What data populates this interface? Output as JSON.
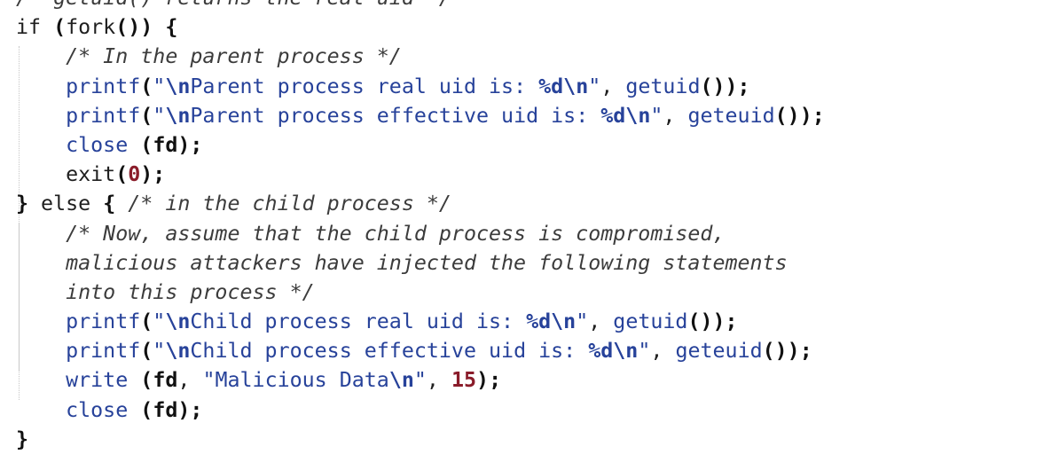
{
  "code_lines": [
    [
      {
        "t": "/* getuid() returns the real uid */",
        "c": "c-cmt"
      }
    ],
    [
      {
        "t": "if ",
        "c": "c-kw"
      },
      {
        "t": "(",
        "c": "c-punct"
      },
      {
        "t": "fork",
        "c": "c-fn"
      },
      {
        "t": "()) {",
        "c": "c-punct"
      }
    ],
    [
      {
        "t": "    ",
        "c": "c-plain"
      },
      {
        "t": "/* In the parent process */",
        "c": "c-cmt"
      }
    ],
    [
      {
        "t": "    ",
        "c": "c-plain"
      },
      {
        "t": "printf",
        "c": "c-call"
      },
      {
        "t": "(",
        "c": "c-punct"
      },
      {
        "t": "\"",
        "c": "c-str"
      },
      {
        "t": "\\n",
        "c": "c-esc"
      },
      {
        "t": "Parent process real uid is: ",
        "c": "c-str"
      },
      {
        "t": "%d\\n",
        "c": "c-esc"
      },
      {
        "t": "\"",
        "c": "c-str"
      },
      {
        "t": ", ",
        "c": "c-plain"
      },
      {
        "t": "getuid",
        "c": "c-call"
      },
      {
        "t": "());",
        "c": "c-punct"
      }
    ],
    [
      {
        "t": "    ",
        "c": "c-plain"
      },
      {
        "t": "printf",
        "c": "c-call"
      },
      {
        "t": "(",
        "c": "c-punct"
      },
      {
        "t": "\"",
        "c": "c-str"
      },
      {
        "t": "\\n",
        "c": "c-esc"
      },
      {
        "t": "Parent process effective uid is: ",
        "c": "c-str"
      },
      {
        "t": "%d\\n",
        "c": "c-esc"
      },
      {
        "t": "\"",
        "c": "c-str"
      },
      {
        "t": ", ",
        "c": "c-plain"
      },
      {
        "t": "geteuid",
        "c": "c-call"
      },
      {
        "t": "());",
        "c": "c-punct"
      }
    ],
    [
      {
        "t": "    ",
        "c": "c-plain"
      },
      {
        "t": "close",
        "c": "c-call"
      },
      {
        "t": " (",
        "c": "c-punct"
      },
      {
        "t": "fd",
        "c": "c-bold"
      },
      {
        "t": ");",
        "c": "c-punct"
      }
    ],
    [
      {
        "t": "    ",
        "c": "c-plain"
      },
      {
        "t": "exit",
        "c": "c-fn"
      },
      {
        "t": "(",
        "c": "c-punct"
      },
      {
        "t": "0",
        "c": "c-num"
      },
      {
        "t": ");",
        "c": "c-punct"
      }
    ],
    [
      {
        "t": "}",
        "c": "c-punct"
      },
      {
        "t": " else ",
        "c": "c-kw"
      },
      {
        "t": "{ ",
        "c": "c-punct"
      },
      {
        "t": "/* in the child process */",
        "c": "c-cmt"
      }
    ],
    [
      {
        "t": "    ",
        "c": "c-plain"
      },
      {
        "t": "/* Now, assume that the child process is compromised,",
        "c": "c-cmt"
      }
    ],
    [
      {
        "t": "    ",
        "c": "c-plain"
      },
      {
        "t": "malicious attackers have injected the following statements",
        "c": "c-cmt"
      }
    ],
    [
      {
        "t": "    ",
        "c": "c-plain"
      },
      {
        "t": "into this process */",
        "c": "c-cmt"
      }
    ],
    [
      {
        "t": "    ",
        "c": "c-plain"
      },
      {
        "t": "printf",
        "c": "c-call"
      },
      {
        "t": "(",
        "c": "c-punct"
      },
      {
        "t": "\"",
        "c": "c-str"
      },
      {
        "t": "\\n",
        "c": "c-esc"
      },
      {
        "t": "Child process real uid is: ",
        "c": "c-str"
      },
      {
        "t": "%d\\n",
        "c": "c-esc"
      },
      {
        "t": "\"",
        "c": "c-str"
      },
      {
        "t": ", ",
        "c": "c-plain"
      },
      {
        "t": "getuid",
        "c": "c-call"
      },
      {
        "t": "());",
        "c": "c-punct"
      }
    ],
    [
      {
        "t": "    ",
        "c": "c-plain"
      },
      {
        "t": "printf",
        "c": "c-call"
      },
      {
        "t": "(",
        "c": "c-punct"
      },
      {
        "t": "\"",
        "c": "c-str"
      },
      {
        "t": "\\n",
        "c": "c-esc"
      },
      {
        "t": "Child process effective uid is: ",
        "c": "c-str"
      },
      {
        "t": "%d\\n",
        "c": "c-esc"
      },
      {
        "t": "\"",
        "c": "c-str"
      },
      {
        "t": ", ",
        "c": "c-plain"
      },
      {
        "t": "geteuid",
        "c": "c-call"
      },
      {
        "t": "());",
        "c": "c-punct"
      }
    ],
    [
      {
        "t": "    ",
        "c": "c-plain"
      },
      {
        "t": "write",
        "c": "c-call"
      },
      {
        "t": " (",
        "c": "c-punct"
      },
      {
        "t": "fd",
        "c": "c-bold"
      },
      {
        "t": ", ",
        "c": "c-plain"
      },
      {
        "t": "\"Malicious Data",
        "c": "c-str"
      },
      {
        "t": "\\n",
        "c": "c-esc"
      },
      {
        "t": "\"",
        "c": "c-str"
      },
      {
        "t": ", ",
        "c": "c-plain"
      },
      {
        "t": "15",
        "c": "c-num"
      },
      {
        "t": ");",
        "c": "c-punct"
      }
    ],
    [
      {
        "t": "    ",
        "c": "c-plain"
      },
      {
        "t": "close",
        "c": "c-call"
      },
      {
        "t": " (",
        "c": "c-punct"
      },
      {
        "t": "fd",
        "c": "c-bold"
      },
      {
        "t": ");",
        "c": "c-punct"
      }
    ],
    [
      {
        "t": "}",
        "c": "c-punct"
      }
    ]
  ],
  "colors": {
    "background": "#ffffff",
    "text": "#1f1f1f",
    "comment": "#3c3c3c",
    "function_call": "#27429a",
    "string": "#27429a",
    "number": "#8a1c2a",
    "indent_guide": "#c7c7c7"
  }
}
